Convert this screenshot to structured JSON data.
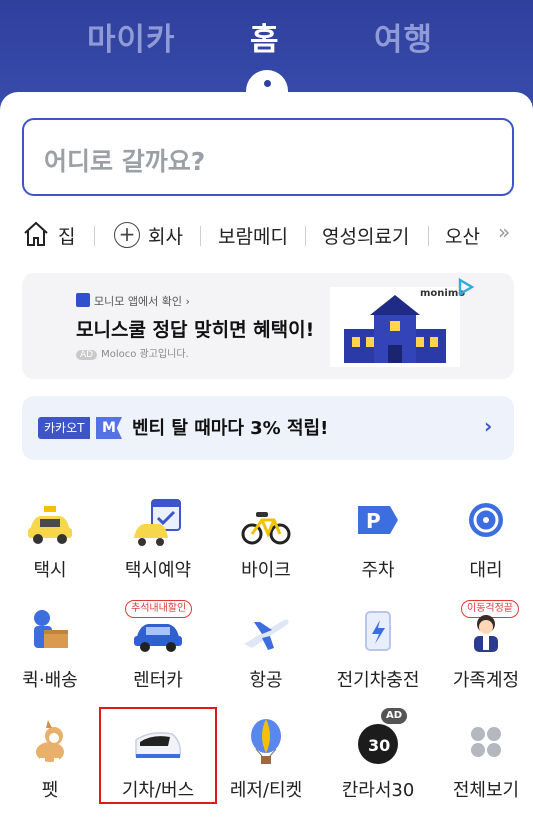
{
  "tabs": [
    {
      "label": "마이카"
    },
    {
      "label": "홈"
    },
    {
      "label": "여행"
    }
  ],
  "search": {
    "placeholder": "어디로 갈까요?"
  },
  "shortcuts": {
    "items": [
      "집",
      "회사",
      "보람메디",
      "영성의료기",
      "오산"
    ]
  },
  "ad_banner": {
    "source": "모니모 앱에서 확인 ›",
    "title": "모니스쿨 정답 맞히면 혜택이!",
    "badge": "AD",
    "label": "Moloco 광고입니다.",
    "brand": "monimo"
  },
  "promo": {
    "tag1": "카카오T",
    "tag2": "M",
    "text": "벤티 탈 때마다 3% 적립!",
    "arrow": "›"
  },
  "services": [
    {
      "label": "택시",
      "icon": "taxi-icon"
    },
    {
      "label": "택시예약",
      "icon": "taxi-reservation-icon"
    },
    {
      "label": "바이크",
      "icon": "bike-icon"
    },
    {
      "label": "주차",
      "icon": "parking-icon"
    },
    {
      "label": "대리",
      "icon": "driver-service-icon"
    },
    {
      "label": "퀵·배송",
      "icon": "delivery-icon"
    },
    {
      "label": "렌터카",
      "icon": "rental-car-icon",
      "bubble": "추석내내할인"
    },
    {
      "label": "항공",
      "icon": "airplane-icon"
    },
    {
      "label": "전기차충전",
      "icon": "ev-charger-icon"
    },
    {
      "label": "가족계정",
      "icon": "family-account-icon",
      "bubble": "이동걱정끝"
    },
    {
      "label": "펫",
      "icon": "pet-icon"
    },
    {
      "label": "기차/버스",
      "icon": "train-icon"
    },
    {
      "label": "레저/티켓",
      "icon": "balloon-icon"
    },
    {
      "label": "칸라서30",
      "icon": "kanraser-icon",
      "chip": "AD"
    },
    {
      "label": "전체보기",
      "icon": "all-grid-icon"
    }
  ],
  "colors": {
    "brand": "#3a4fb0",
    "accent": "#3d55c8",
    "highlight": "#e0191a"
  }
}
